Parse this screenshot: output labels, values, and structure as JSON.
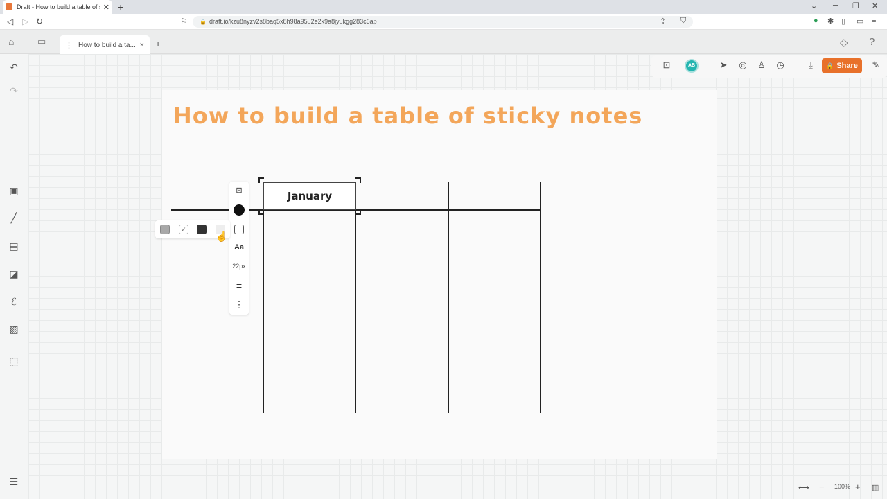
{
  "browser": {
    "tab_title": "Draft - How to build a table of sti",
    "tab_close": "✕",
    "new_tab": "+",
    "url": "draft.io/kzu8nyzv2s8baq5x8h98a95u2e2k9a8jyukgg283c6ap"
  },
  "app_tabs": {
    "active_tab_label": "How to build a ta...",
    "close": "×",
    "new_tab": "+"
  },
  "board": {
    "title": "How to build a table of sticky notes",
    "sticky_note_text": "January"
  },
  "toolbar": {
    "avatar_initials": "AB",
    "share_label": "Share"
  },
  "context_toolbar": {
    "font_label": "Aa",
    "font_size": "22px"
  },
  "colors": {
    "accent": "#e8712b",
    "title": "#f3a65a",
    "avatar": "#23b5b0"
  },
  "zoom": {
    "level": "100%"
  }
}
